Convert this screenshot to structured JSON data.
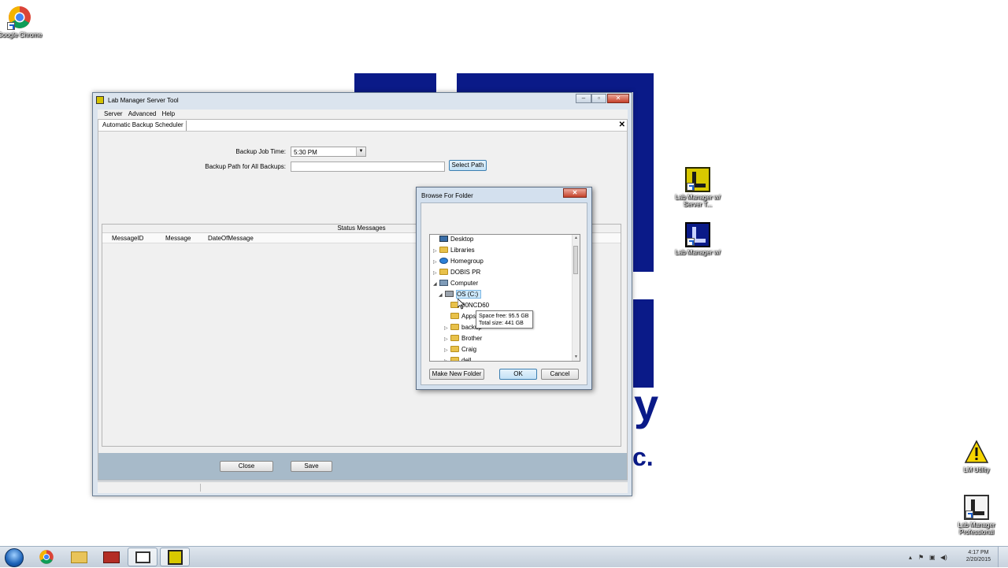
{
  "desktop": {
    "icons": [
      {
        "label": "Google Chrome",
        "icon": "chrome-icon"
      },
      {
        "label": "Lab Manager w/ Server T...",
        "icon": "lab-manager-server-icon"
      },
      {
        "label": "Lab Manager w/",
        "icon": "lab-manager-icon"
      },
      {
        "label": "LM Utility",
        "icon": "warning-icon"
      },
      {
        "label": "Lab Manager Professional",
        "icon": "lab-manager-professional-icon"
      }
    ],
    "wallpaper_letters": {
      "y": "y",
      "c": "c."
    },
    "colors": {
      "wallpaper_blue": "#0a1a88"
    }
  },
  "window": {
    "title": "Lab Manager Server Tool",
    "controls": {
      "minimize": "–",
      "maximize": "▫",
      "close": "✕"
    },
    "menu": [
      "Server",
      "Advanced",
      "Help"
    ],
    "tab": "Automatic Backup Scheduler",
    "tab_close": "✕",
    "form": {
      "backup_job_time_label": "Backup Job Time:",
      "backup_job_time_value": "5:30 PM",
      "backup_path_label": "Backup Path for All Backups:",
      "backup_path_value": "",
      "select_path_button": "Select Path"
    },
    "status": {
      "title": "Status Messages",
      "columns": [
        "MessageID",
        "Message",
        "DateOfMessage"
      ]
    },
    "buttons": {
      "close": "Close",
      "save": "Save"
    }
  },
  "dialog": {
    "title": "Browse For Folder",
    "close": "✕",
    "tree": [
      {
        "label": "Desktop",
        "icon": "desktop-icon"
      },
      {
        "label": "Libraries",
        "icon": "libraries-icon"
      },
      {
        "label": "Homegroup",
        "icon": "homegroup-icon"
      },
      {
        "label": "DOBIS PR",
        "icon": "user-folder-icon"
      },
      {
        "label": "Computer",
        "icon": "computer-icon"
      },
      {
        "label": "OS (C:)",
        "icon": "drive-icon"
      },
      {
        "label": "00NCD60",
        "icon": "folder-icon"
      },
      {
        "label": "Apps",
        "icon": "folder-icon"
      },
      {
        "label": "backup",
        "icon": "folder-icon"
      },
      {
        "label": "Brother",
        "icon": "folder-icon"
      },
      {
        "label": "Craig",
        "icon": "folder-icon"
      },
      {
        "label": "dell",
        "icon": "folder-icon"
      }
    ],
    "tooltip": {
      "line1": "Space free: 95.5 GB",
      "line2": "Total size: 441 GB"
    },
    "buttons": {
      "make_new_folder": "Make New Folder",
      "ok": "OK",
      "cancel": "Cancel"
    }
  },
  "taskbar": {
    "apps": [
      "start-orb",
      "chrome-icon",
      "explorer-icon",
      "toolbox-icon",
      "window-app-icon",
      "lab-manager-icon"
    ],
    "clock": {
      "time": "4:17 PM",
      "date": "2/20/2015"
    }
  }
}
